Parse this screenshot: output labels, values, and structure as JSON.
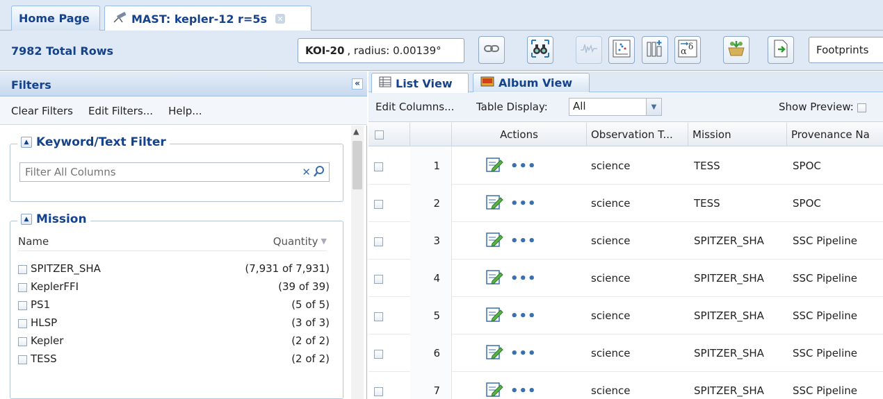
{
  "tabs": [
    {
      "label": "Home Page"
    },
    {
      "label": "MAST: kepler-12 r=5s",
      "icon": "telescope-icon"
    }
  ],
  "toolbar": {
    "total_rows": "7982 Total Rows",
    "target_name": "KOI-20",
    "target_radius": ", radius: 0.00139°",
    "footprints_label": "Footprints"
  },
  "filters": {
    "title": "Filters",
    "menu": {
      "clear": "Clear Filters",
      "edit": "Edit Filters...",
      "help": "Help..."
    },
    "keyword": {
      "title": "Keyword/Text Filter",
      "placeholder": "Filter All Columns"
    },
    "mission": {
      "title": "Mission",
      "col_name": "Name",
      "col_qty": "Quantity",
      "items": [
        {
          "name": "SPITZER_SHA",
          "qty": "(7,931 of 7,931)"
        },
        {
          "name": "KeplerFFI",
          "qty": "(39 of 39)"
        },
        {
          "name": "PS1",
          "qty": "(5 of 5)"
        },
        {
          "name": "HLSP",
          "qty": "(3 of 3)"
        },
        {
          "name": "Kepler",
          "qty": "(2 of 2)"
        },
        {
          "name": "TESS",
          "qty": "(2 of 2)"
        }
      ]
    }
  },
  "view_tabs": {
    "list": "List View",
    "album": "Album View"
  },
  "grid_toolbar": {
    "edit_columns": "Edit Columns...",
    "table_display_label": "Table Display:",
    "table_display_value": "All",
    "show_preview": "Show Preview:"
  },
  "grid": {
    "columns": {
      "actions": "Actions",
      "obs_type": "Observation T...",
      "mission": "Mission",
      "provenance": "Provenance Na"
    },
    "rows": [
      {
        "num": "1",
        "obs_type": "science",
        "mission": "TESS",
        "provenance": "SPOC"
      },
      {
        "num": "2",
        "obs_type": "science",
        "mission": "TESS",
        "provenance": "SPOC"
      },
      {
        "num": "3",
        "obs_type": "science",
        "mission": "SPITZER_SHA",
        "provenance": "SSC Pipeline"
      },
      {
        "num": "4",
        "obs_type": "science",
        "mission": "SPITZER_SHA",
        "provenance": "SSC Pipeline"
      },
      {
        "num": "5",
        "obs_type": "science",
        "mission": "SPITZER_SHA",
        "provenance": "SSC Pipeline"
      },
      {
        "num": "6",
        "obs_type": "science",
        "mission": "SPITZER_SHA",
        "provenance": "SSC Pipeline"
      },
      {
        "num": "7",
        "obs_type": "science",
        "mission": "SPITZER_SHA",
        "provenance": "SSC Pipeline"
      }
    ]
  },
  "colors": {
    "accent": "#15428b",
    "panel_bg": "#dfe9f5",
    "border": "#99bbe8"
  }
}
